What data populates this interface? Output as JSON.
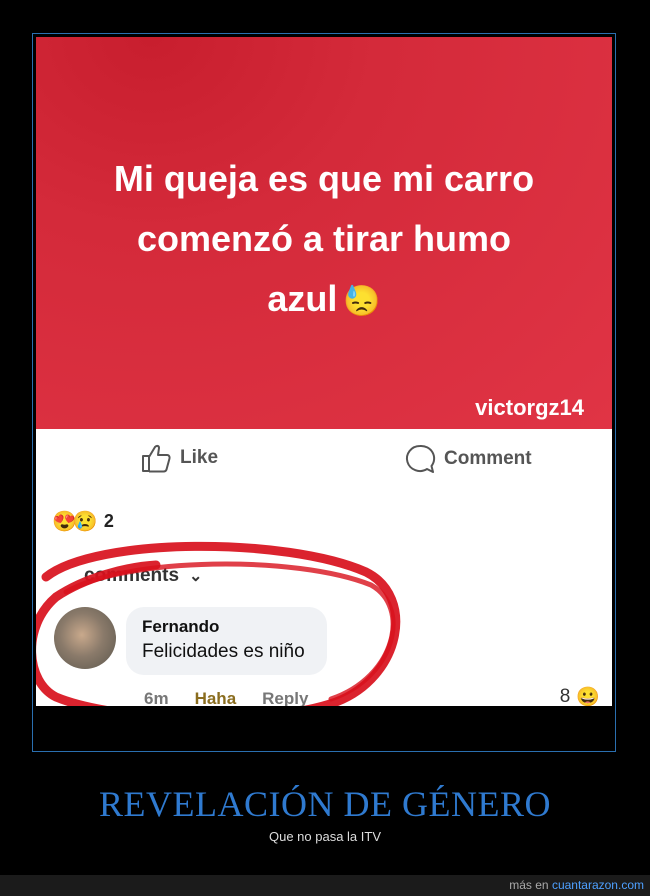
{
  "post": {
    "line1": "Mi queja es que mi carro",
    "line2": "comenzó a tirar humo",
    "line3": "azul",
    "emoji": "😓",
    "username": "victorgz14"
  },
  "actions": {
    "like_label": "Like",
    "comment_label": "Comment"
  },
  "reactions": {
    "icons": [
      "😍",
      "😢"
    ],
    "count": "2"
  },
  "comments": {
    "header": "comments",
    "chevron": "⌄",
    "items": [
      {
        "author": "Fernando",
        "text": "Felicidades es niño",
        "time": "6m",
        "react": "Haha",
        "reply": "Reply",
        "reaction_count": "8",
        "reaction_icon": "😀"
      }
    ]
  },
  "caption": {
    "title": "REVELACIÓN DE GÉNERO",
    "subtitle": "Que no pasa la ITV"
  },
  "footer": {
    "prefix": "más en",
    "site": "cuantarazon.com"
  },
  "colors": {
    "banner_red": "#e03445",
    "circle_red": "#d8101c",
    "caption_blue": "#2f7ad0",
    "link_blue": "#4ea0ff"
  }
}
